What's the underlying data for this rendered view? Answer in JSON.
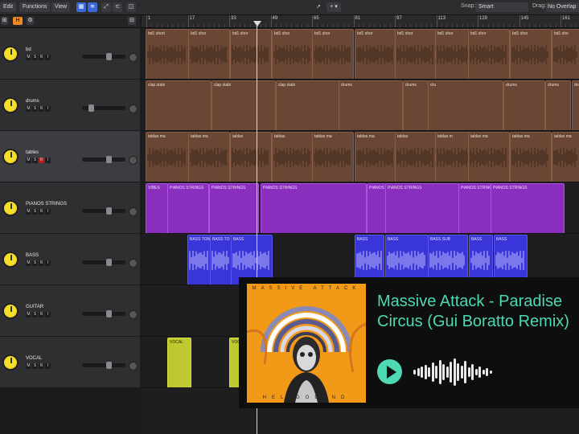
{
  "menubar": {
    "edit": "Edit",
    "functions": "Functions",
    "view": "View",
    "snap_label": "Snap:",
    "snap_value": "Smart",
    "drag_label": "Drag:",
    "drag_value": "No Overlap"
  },
  "header": {
    "h_button": "H"
  },
  "ruler": {
    "bars": [
      "1",
      "17",
      "33",
      "49",
      "65",
      "81",
      "97",
      "113",
      "129",
      "145",
      "161"
    ]
  },
  "tracks": [
    {
      "name": "bd",
      "color": "#6a4734"
    },
    {
      "name": "drums",
      "color": "#6a4734"
    },
    {
      "name": "tables",
      "color": "#6a4734"
    },
    {
      "name": "PIANOS STRINGS",
      "color": "#8a2fbd"
    },
    {
      "name": "BASS",
      "color": "#3a35d8"
    },
    {
      "name": "GUITAR",
      "color": "#bfc831"
    },
    {
      "name": "VOCAL",
      "color": "#bfc831"
    }
  ],
  "track_buttons": {
    "m": "M",
    "s": "S",
    "r": "R",
    "i": "I"
  },
  "regions": {
    "bd": [
      "bd1 short",
      "bd1 shor",
      "bd1 shor",
      "bd1 shor",
      "bd1 shor",
      "bd1 shor",
      "bd1 shor",
      "bd1 shor",
      "bd1 shor",
      "bd1 shor",
      "bd1 sho"
    ],
    "drums": [
      "clap stabi",
      "clap stabi",
      "clap stabi",
      "drums",
      "drums",
      "dru",
      "drums",
      "drums",
      "drums"
    ],
    "tables": [
      "tablas ma",
      "tablas ma",
      "tablas",
      "tablas",
      "tablas ma",
      "tablas ma",
      "tablas",
      "tablas m",
      "tablas ma",
      "tablas ma",
      "tablas ma"
    ],
    "pianos": [
      "VIBES",
      "PIANOS STRINGS",
      "PIANOS STRINGS",
      "PIANOS STRINGS",
      "PIANOS STRINGS",
      "PIANOS STRINGS",
      "PIANOS STRINGS",
      "PIANOS STRINGS"
    ],
    "bass": [
      "BASS TON",
      "BASS TO",
      "BASS",
      "BASS",
      "BASS",
      "BASS SUB",
      "BASS",
      "BASS"
    ],
    "vocal": [
      "VOCAL",
      "VOCAL"
    ]
  },
  "player": {
    "album_artist_text": "MASSIVE ATTACK",
    "album_title_text": "HELIGOLAND",
    "title": "Massive Attack - Paradise Circus (Gui Boratto Remix)"
  },
  "colors": {
    "accent": "#4cd9b4",
    "album": "#f29a17"
  }
}
